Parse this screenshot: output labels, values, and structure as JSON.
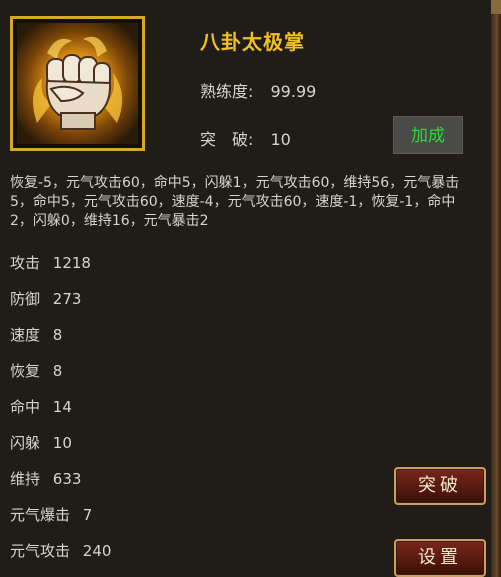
{
  "skill": {
    "name": "八卦太极掌",
    "icon": "fist-icon",
    "proficiency_label": "熟练度:",
    "proficiency_value": "99.99",
    "breakthrough_label": "突　破:",
    "breakthrough_value": "10",
    "upgrade_label": "加成"
  },
  "description": "恢复-5，元气攻击60，命中5，闪躲1，元气攻击60，维持56，元气暴击5，命中5，元气攻击60，速度-4，元气攻击60，速度-1，恢复-1，命中2，闪躲0，维持16，元气暴击2",
  "attributes": [
    {
      "name": "攻击",
      "value": "1218"
    },
    {
      "name": "防御",
      "value": "273"
    },
    {
      "name": "速度",
      "value": "8"
    },
    {
      "name": "恢复",
      "value": "8"
    },
    {
      "name": "命中",
      "value": "14"
    },
    {
      "name": "闪躲",
      "value": "10"
    },
    {
      "name": "维持",
      "value": "633"
    },
    {
      "name": "元气爆击",
      "value": "7"
    },
    {
      "name": "元气攻击",
      "value": "240"
    }
  ],
  "buttons": {
    "breakthrough": "突破",
    "settings": "设置"
  },
  "colors": {
    "background": "#201c18",
    "skill_name": "#f0c020",
    "upgrade_text": "#2fd838",
    "icon_border": "#d6a825"
  }
}
